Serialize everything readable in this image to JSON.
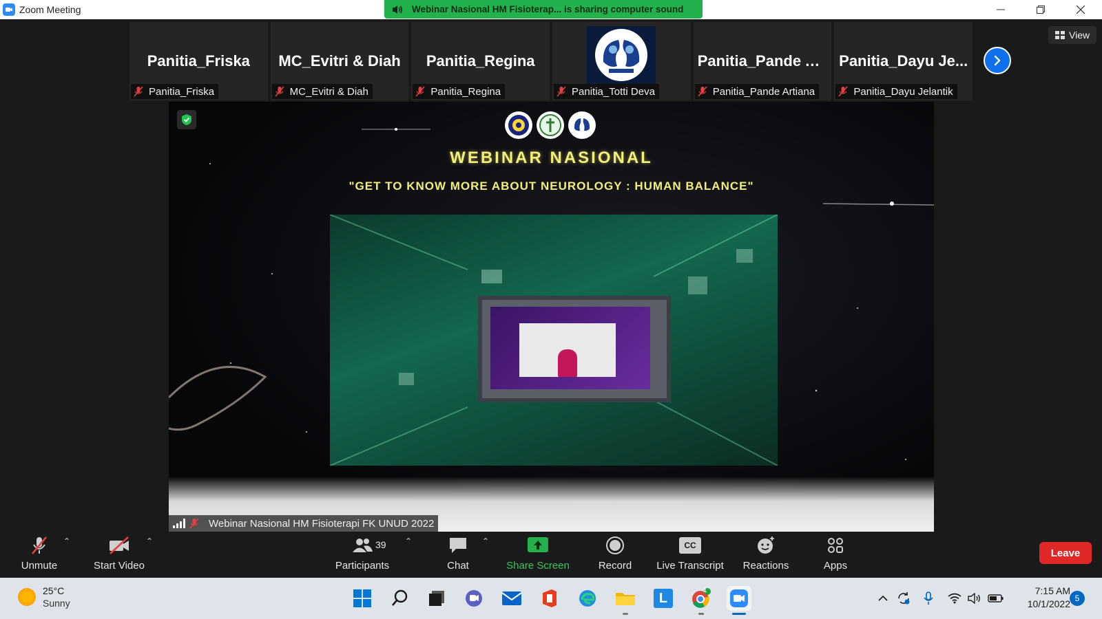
{
  "window": {
    "title": "Zoom Meeting",
    "share_banner": "Webinar Nasional HM Fisioterap... is sharing computer sound"
  },
  "participants_strip": [
    {
      "display": "Panitia_Friska",
      "tag": "Panitia_Friska",
      "has_avatar": false
    },
    {
      "display": "MC_Evitri & Diah",
      "tag": "MC_Evitri & Diah",
      "has_avatar": false
    },
    {
      "display": "Panitia_Regina",
      "tag": "Panitia_Regina",
      "has_avatar": false
    },
    {
      "display": "",
      "tag": "Panitia_Totti Deva",
      "has_avatar": true
    },
    {
      "display": "Panitia_Pande A...",
      "tag": "Panitia_Pande Artiana",
      "has_avatar": false
    },
    {
      "display": "Panitia_Dayu Je...",
      "tag": "Panitia_Dayu Jelantik",
      "has_avatar": false
    }
  ],
  "view_button": "View",
  "shared_screen": {
    "headline": "WEBINAR NASIONAL",
    "subline": "\"GET TO KNOW MORE ABOUT NEUROLOGY : HUMAN BALANCE\"",
    "sharer_name": "Webinar Nasional HM Fisioterapi FK UNUD 2022"
  },
  "toolbar": {
    "unmute": "Unmute",
    "start_video": "Start Video",
    "participants": "Participants",
    "participant_count": "39",
    "chat": "Chat",
    "share_screen": "Share Screen",
    "record": "Record",
    "live_transcript": "Live Transcript",
    "cc": "CC",
    "reactions": "Reactions",
    "apps": "Apps",
    "leave": "Leave"
  },
  "taskbar": {
    "temperature": "25°C",
    "condition": "Sunny",
    "time": "7:15 AM",
    "date": "10/1/2022",
    "notification_count": "5",
    "chrome_badge": "1",
    "app_l_letter": "L"
  },
  "colors": {
    "share_banner": "#22b14c",
    "accent_blue": "#0e71eb",
    "leave_red": "#e02828",
    "headline_yellow": "#f3f07a",
    "share_green": "#35c759"
  }
}
